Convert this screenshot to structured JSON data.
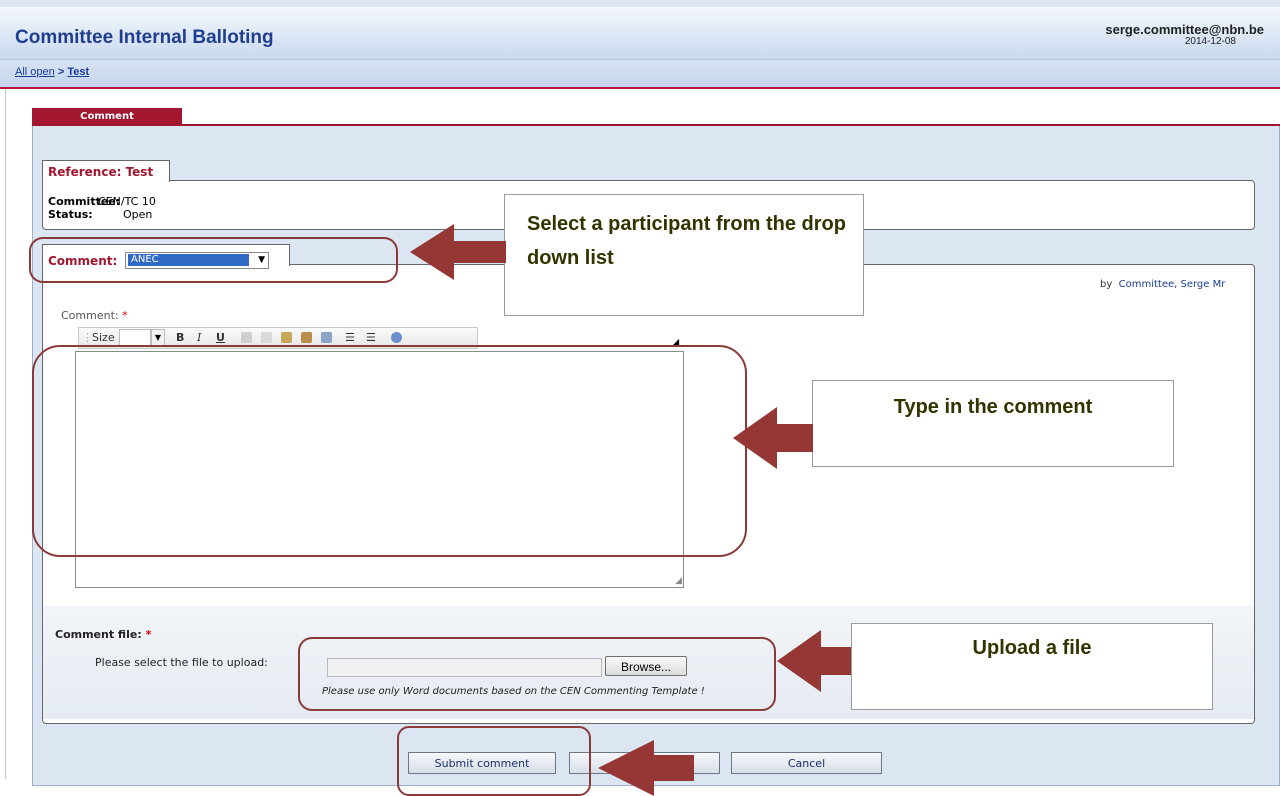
{
  "header": {
    "title": "Committee Internal Balloting",
    "user_email": "serge.committee@nbn.be",
    "date": "2014-12-08"
  },
  "breadcrumb": {
    "link": "All open",
    "separator": ">",
    "current": "Test"
  },
  "tabs": {
    "comment": "Comment"
  },
  "reference": {
    "label": "Reference: Test",
    "committee_label": "Committee:",
    "committee_value": "CEN/TC 10",
    "status_label": "Status:",
    "status_value": "Open"
  },
  "comment_section": {
    "label": "Comment:",
    "selected_participant": "ANEC",
    "by_prefix": "by",
    "by_name": "Committee, Serge Mr",
    "field_label": "Comment:",
    "required_mark": "*",
    "toolbar_size": "Size",
    "toolbar_bold": "B",
    "toolbar_italic": "I",
    "toolbar_underline": "U"
  },
  "file_section": {
    "label": "Comment file:",
    "required_mark": "*",
    "prompt": "Please select the file to upload:",
    "browse_label": "Browse...",
    "hint": "Please use only Word documents based on the CEN Commenting Template !"
  },
  "buttons": {
    "submit": "Submit comment",
    "cancel": "Cancel"
  },
  "callouts": {
    "select_participant": "Select a participant from the drop down list",
    "type_comment": "Type in the comment",
    "upload_file": "Upload a file"
  },
  "colors": {
    "accent": "#a3162f",
    "title": "#1f3f8e",
    "arrow": "#953735"
  }
}
